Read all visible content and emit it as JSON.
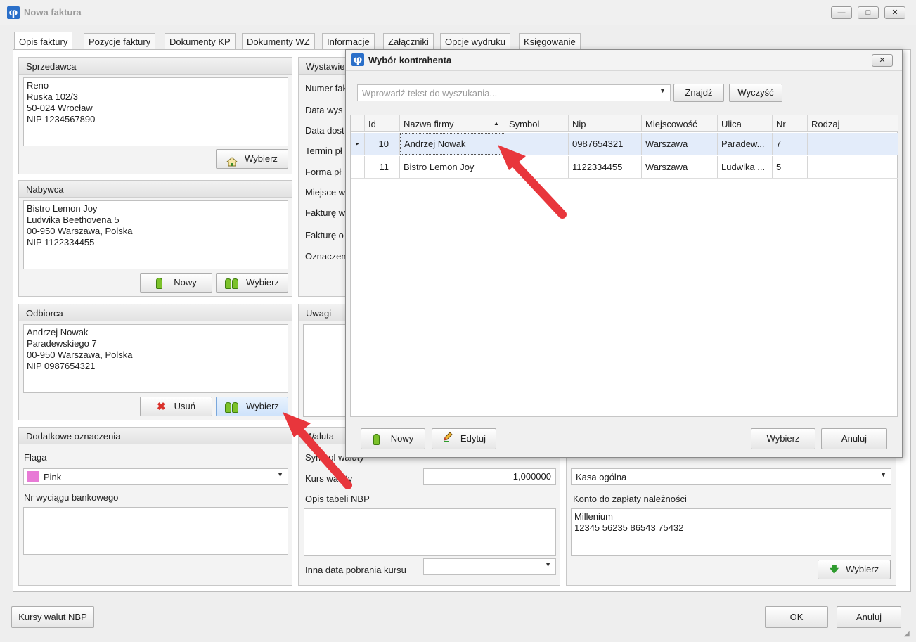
{
  "window": {
    "title": "Nowa faktura",
    "app_icon": "φ",
    "minimize": "—",
    "maximize": "□",
    "close": "✕"
  },
  "tabs": [
    "Opis faktury",
    "Pozycje faktury",
    "Dokumenty KP",
    "Dokumenty WZ",
    "Informacje",
    "Załączniki",
    "Opcje wydruku",
    "Księgowanie"
  ],
  "sprzedawca": {
    "title": "Sprzedawca",
    "text": "Reno\nRuska 102/3\n50-024 Wrocław\nNIP 1234567890",
    "select_button": "Wybierz"
  },
  "nabywca": {
    "title": "Nabywca",
    "text": "Bistro Lemon Joy\nLudwika Beethovena 5\n00-950 Warszawa, Polska\nNIP 1122334455",
    "new_button": "Nowy",
    "select_button": "Wybierz"
  },
  "odbiorca": {
    "title": "Odbiorca",
    "text": "Andrzej Nowak\nParadewskiego 7\n00-950 Warszawa, Polska\nNIP 0987654321",
    "remove_button": "Usuń",
    "select_button": "Wybierz"
  },
  "wystawienie": {
    "title": "Wystawie",
    "labels": [
      "Numer fak",
      "Data wys",
      "Data dost",
      "Termin pł",
      "Forma pł",
      "Miejsce w",
      "Fakturę w",
      "Fakturę o",
      "Oznaczen"
    ]
  },
  "uwagi": {
    "title": "Uwagi"
  },
  "dodatkowe": {
    "title": "Dodatkowe oznaczenia",
    "flag_label": "Flaga",
    "flag_value": "Pink",
    "flag_color": "#e87ad6",
    "bank_statement_label": "Nr wyciągu bankowego"
  },
  "waluta": {
    "title": "Waluta",
    "symbol_label": "Symbol waluty",
    "rate_label": "Kurs waluty",
    "rate_value": "1,000000",
    "nbp_table_label": "Opis tabeli NBP",
    "other_date_label": "Inna data pobrania kursu"
  },
  "platnosc": {
    "cash_value": "Kasa ogólna",
    "account_label": "Konto do zapłaty należności",
    "account_text": "Millenium\n12345 56235 86543 75432",
    "select_button": "Wybierz"
  },
  "footer": {
    "nbp_button": "Kursy walut NBP",
    "ok_button": "OK",
    "cancel_button": "Anuluj"
  },
  "dialog": {
    "title": "Wybór kontrahenta",
    "close": "✕",
    "search_placeholder": "Wprowadź tekst do wyszukania...",
    "find_button": "Znajdź",
    "clear_button": "Wyczyść",
    "columns": [
      "Id",
      "Nazwa firmy",
      "Symbol",
      "Nip",
      "Miejscowość",
      "Ulica",
      "Nr",
      "Rodzaj"
    ],
    "sort_indicator": "▲",
    "rows": [
      {
        "id": "10",
        "name": "Andrzej Nowak",
        "symbol": "",
        "nip": "0987654321",
        "city": "Warszawa",
        "street": "Paradew...",
        "nr": "7",
        "kind": ""
      },
      {
        "id": "11",
        "name": "Bistro Lemon Joy",
        "symbol": "",
        "nip": "1122334455",
        "city": "Warszawa",
        "street": "Ludwika ...",
        "nr": "5",
        "kind": ""
      }
    ],
    "row_indicator": "▸",
    "new_button": "Nowy",
    "edit_button": "Edytuj",
    "select_button": "Wybierz",
    "cancel_button": "Anuluj"
  },
  "colors": {
    "accent": "#2a6fc9",
    "annotation_arrow": "#e8363c",
    "selected_row": "#e3ecfa"
  }
}
